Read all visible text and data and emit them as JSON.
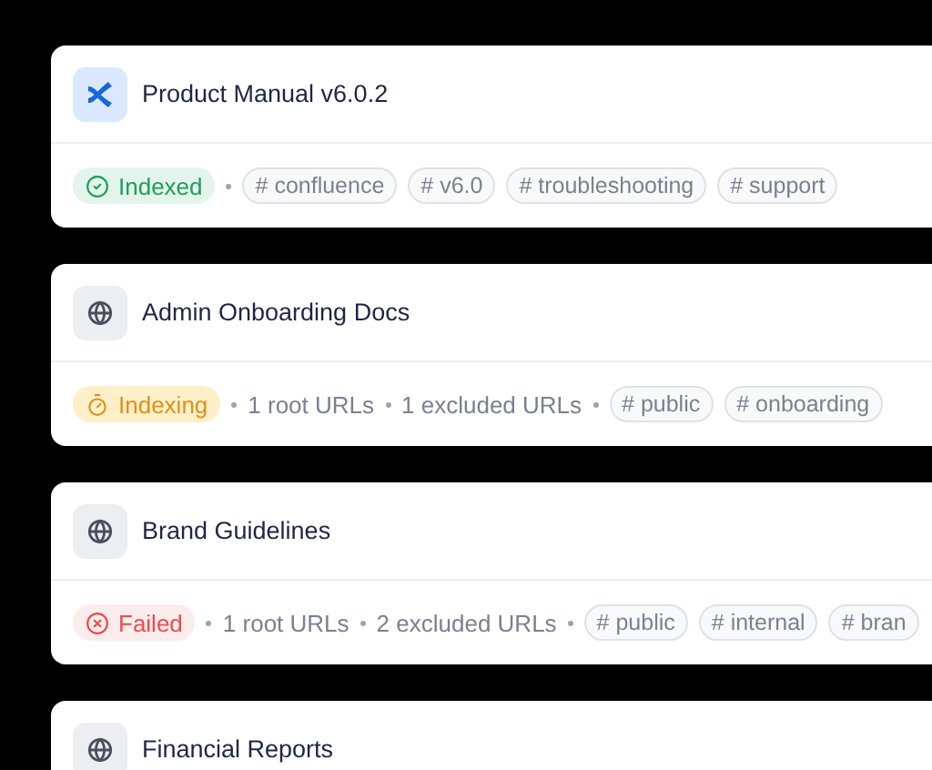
{
  "sources": [
    {
      "title": "Product Manual v6.0.2",
      "kind": "confluence",
      "status": {
        "kind": "indexed",
        "label": "Indexed"
      },
      "tags": [
        "# confluence",
        "# v6.0",
        "# troubleshooting",
        "# support"
      ]
    },
    {
      "title": "Admin Onboarding Docs",
      "kind": "web",
      "status": {
        "kind": "indexing",
        "label": "Indexing"
      },
      "meta": [
        "1 root URLs",
        "1 excluded URLs"
      ],
      "tags": [
        "# public",
        "# onboarding"
      ]
    },
    {
      "title": "Brand Guidelines",
      "kind": "web",
      "status": {
        "kind": "failed",
        "label": "Failed"
      },
      "meta": [
        "1 root URLs",
        "2 excluded URLs"
      ],
      "tags": [
        "# public",
        "# internal",
        "# bran"
      ]
    },
    {
      "title": "Financial Reports",
      "kind": "web"
    }
  ]
}
